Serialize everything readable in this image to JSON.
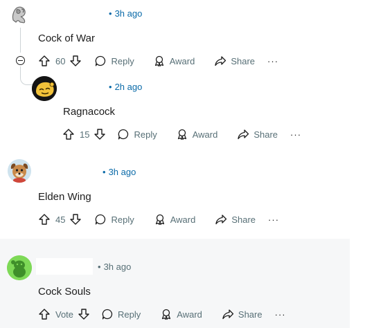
{
  "colors": {
    "accent": "#0a6aa8",
    "muted": "#576f76",
    "text": "#1c1c1c",
    "thread": "#cdd3d6",
    "highlight_bg": "#f6f7f8"
  },
  "comments": [
    {
      "time": "3h ago",
      "text": "Cock of War",
      "votes": "60",
      "reply": "Reply",
      "award": "Award",
      "share": "Share",
      "more": "···",
      "avatar": "silver-chrome-avatar"
    },
    {
      "time": "2h ago",
      "text": "Ragnacock",
      "votes": "15",
      "reply": "Reply",
      "award": "Award",
      "share": "Share",
      "more": "···",
      "avatar": "yellow-cartoon-avatar"
    },
    {
      "time": "3h ago",
      "text": "Elden Wing",
      "votes": "45",
      "reply": "Reply",
      "award": "Award",
      "share": "Share",
      "more": "···",
      "avatar": "dog-avatar"
    },
    {
      "time": "3h ago",
      "text": "Cock Souls",
      "votes": "Vote",
      "reply": "Reply",
      "award": "Award",
      "share": "Share",
      "more": "···",
      "avatar": "green-snoo-avatar"
    }
  ]
}
